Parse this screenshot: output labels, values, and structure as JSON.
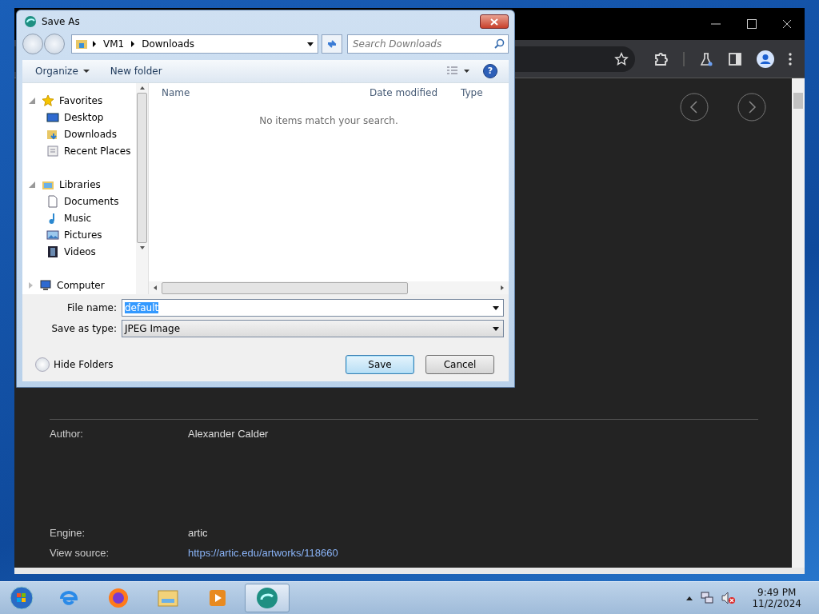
{
  "browser": {
    "content": {
      "rows": [
        {
          "label": "Author:",
          "value": "Alexander Calder",
          "kind": "text"
        },
        {
          "label": "Engine:",
          "value": "artic",
          "kind": "text"
        },
        {
          "label": "View source:",
          "value": "https://artic.edu/artworks/118660",
          "kind": "link"
        }
      ]
    }
  },
  "dialog": {
    "title": "Save As",
    "breadcrumb": [
      "VM1",
      "Downloads"
    ],
    "search": {
      "placeholder": "Search Downloads"
    },
    "toolbar": [
      {
        "label": "Organize",
        "kind": "menu"
      },
      {
        "label": "New folder",
        "kind": "button"
      }
    ],
    "nav": [
      {
        "label": "Favorites",
        "kind": "star",
        "expanded": true,
        "children": [
          {
            "label": "Desktop",
            "kind": "desktop"
          },
          {
            "label": "Downloads",
            "kind": "folder"
          },
          {
            "label": "Recent Places",
            "kind": "recent"
          }
        ]
      },
      {
        "label": "Libraries",
        "kind": "library",
        "expanded": true,
        "children": [
          {
            "label": "Documents",
            "kind": "document"
          },
          {
            "label": "Music",
            "kind": "music"
          },
          {
            "label": "Pictures",
            "kind": "picture"
          },
          {
            "label": "Videos",
            "kind": "video"
          }
        ]
      },
      {
        "label": "Computer",
        "kind": "computer",
        "expanded": false
      }
    ],
    "help": "?",
    "columns": [
      "Name",
      "Date modified",
      "Type"
    ],
    "empty_message": "No items match your search.",
    "file_name": {
      "label": "File name:",
      "value": "default"
    },
    "save_type": {
      "label": "Save as type:",
      "value": "JPEG Image"
    },
    "hide_folders": "Hide Folders",
    "buttons": [
      {
        "label": "Save",
        "default": true
      },
      {
        "label": "Cancel",
        "default": false
      }
    ]
  },
  "taskbar": {
    "apps": [
      {
        "kind": "ie",
        "selected": false
      },
      {
        "kind": "firefox",
        "selected": false
      },
      {
        "kind": "explorer",
        "selected": false
      },
      {
        "kind": "media",
        "selected": false
      },
      {
        "kind": "app",
        "selected": true
      }
    ],
    "clock": {
      "time": "9:49 PM",
      "date": "11/2/2024"
    }
  }
}
